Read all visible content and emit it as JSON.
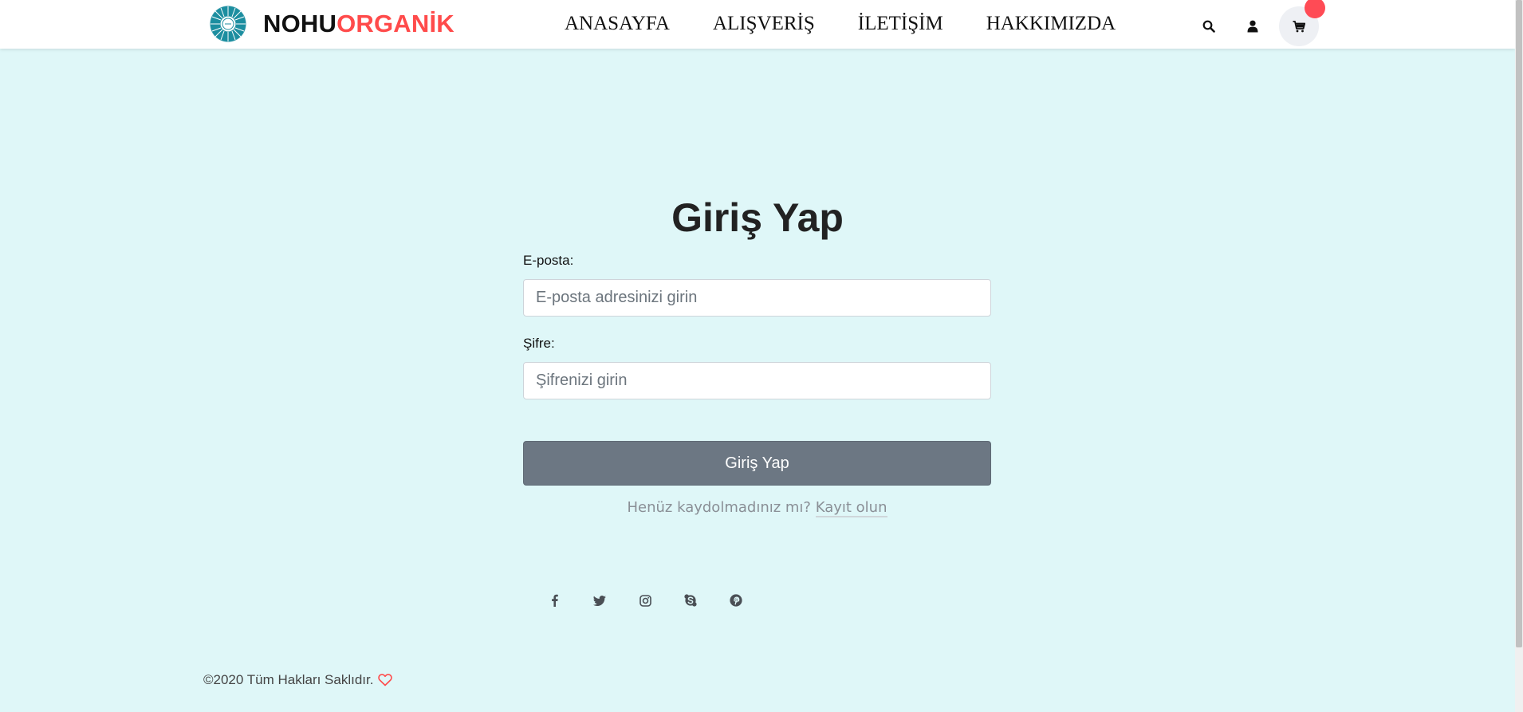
{
  "header": {
    "brand_part1": "NOHU",
    "brand_part2": "ORGANİK",
    "nav": [
      {
        "label": "ANASAYFA"
      },
      {
        "label": "ALIŞVERİŞ"
      },
      {
        "label": "İLETİŞİM"
      },
      {
        "label": "HAKKIMIZDA"
      }
    ],
    "icons": [
      "search-icon",
      "user-icon",
      "cart-icon"
    ]
  },
  "login": {
    "title": "Giriş Yap",
    "email_label": "E-posta:",
    "email_placeholder": "E-posta adresinizi girin",
    "email_value": "",
    "password_label": "Şifre:",
    "password_placeholder": "Şifrenizi girin",
    "password_value": "",
    "submit_label": "Giriş Yap",
    "register_prompt": "Henüz kaydolmadınız mı?",
    "register_link": "Kayıt olun"
  },
  "social": [
    "facebook-icon",
    "twitter-icon",
    "instagram-icon",
    "skype-icon",
    "pinterest-icon"
  ],
  "footer": {
    "copyright": "©2020 Tüm Hakları Saklıdır."
  },
  "colors": {
    "background": "#dff7f8",
    "brand_accent": "#ff4b4b",
    "button": "#6c7783",
    "badge": "#ff4b55",
    "logo": "#1c8ea0"
  }
}
